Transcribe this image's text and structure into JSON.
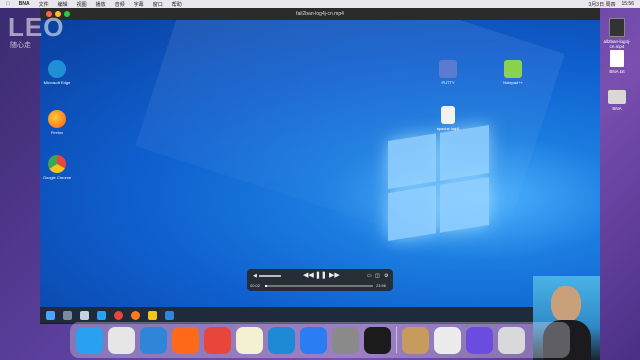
{
  "menubar": {
    "app_name": "BNA",
    "items": [
      "文件",
      "编辑",
      "视图",
      "播放",
      "音频",
      "字幕",
      "窗口",
      "帮助"
    ],
    "right": [
      "3月3日 周四",
      "15:56"
    ]
  },
  "player": {
    "title": "fail2ban-log4j-cn.mp4",
    "time_elapsed": "00:02",
    "time_total": "23:56",
    "progress": 0.002
  },
  "windows_desktop": {
    "icons": [
      {
        "label": "Microsoft Edge",
        "color": "#1f8fd6"
      },
      {
        "label": "Firefox",
        "color": "#ff7a1a"
      },
      {
        "label": "Google Chrome",
        "color": "#e8463a"
      },
      {
        "label": "PUTTY",
        "color": "#5b7bd1"
      },
      {
        "label": "Notepad++",
        "color": "#8bd24f"
      },
      {
        "label": "apache log4j",
        "color": "#f2f2f2"
      }
    ]
  },
  "mac_desktop": {
    "icons": [
      {
        "label": "all2ban-log4j-cn.mp4"
      },
      {
        "label": "BNA.txt"
      },
      {
        "label": "BNA"
      }
    ]
  },
  "watermark": {
    "text": "LEO",
    "subtext": "随心走"
  },
  "dock": {
    "apps": [
      {
        "name": "finder-icon",
        "color": "#2aa0f0"
      },
      {
        "name": "launchpad-icon",
        "color": "#e6e6e6"
      },
      {
        "name": "safari-icon",
        "color": "#2f86d9"
      },
      {
        "name": "firefox-icon",
        "color": "#ff6a1a"
      },
      {
        "name": "chrome-icon",
        "color": "#e8463a"
      },
      {
        "name": "notes-icon",
        "color": "#f4f1d2"
      },
      {
        "name": "vscode-icon",
        "color": "#1e8ad6"
      },
      {
        "name": "appstore-icon",
        "color": "#2a7df2"
      },
      {
        "name": "system-preferences-icon",
        "color": "#8a8a8a"
      },
      {
        "name": "terminal-icon",
        "color": "#1b1b1b"
      },
      {
        "name": "archive-icon",
        "color": "#c69b5d"
      },
      {
        "name": "preview-icon",
        "color": "#ececec"
      },
      {
        "name": "video-player-icon",
        "color": "#6a4ce0"
      },
      {
        "name": "trash-icon",
        "color": "#d9d9d9"
      }
    ]
  }
}
